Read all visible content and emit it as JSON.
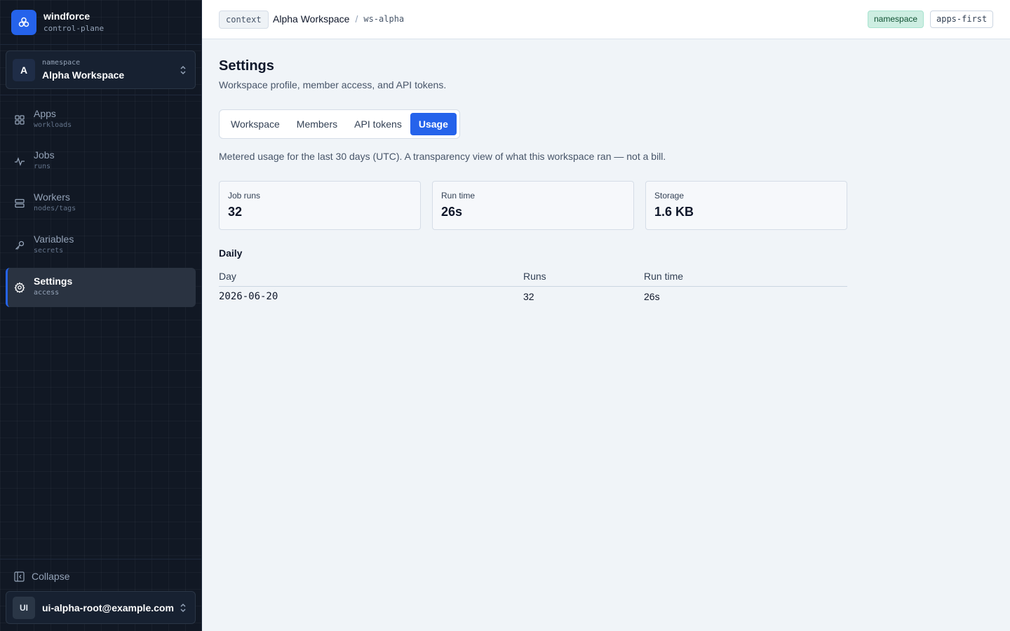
{
  "brand": {
    "name": "windforce",
    "subtitle": "control-plane"
  },
  "namespace_switcher": {
    "avatar": "A",
    "label": "namespace",
    "name": "Alpha Workspace"
  },
  "nav": {
    "items": [
      {
        "label": "Apps",
        "sub": "workloads",
        "icon": "grid-icon"
      },
      {
        "label": "Jobs",
        "sub": "runs",
        "icon": "activity-icon"
      },
      {
        "label": "Workers",
        "sub": "nodes/tags",
        "icon": "server-icon"
      },
      {
        "label": "Variables",
        "sub": "secrets",
        "icon": "key-icon"
      },
      {
        "label": "Settings",
        "sub": "access",
        "icon": "gear-icon",
        "active": true
      }
    ]
  },
  "footer": {
    "collapse_label": "Collapse",
    "user_avatar": "UI",
    "user_email": "ui-alpha-root@example.com"
  },
  "topbar": {
    "context_label": "context",
    "workspace_name": "Alpha Workspace",
    "separator": "/",
    "workspace_id": "ws-alpha",
    "tag_namespace": "namespace",
    "tag_apps": "apps-first"
  },
  "page": {
    "title": "Settings",
    "description": "Workspace profile, member access, and API tokens.",
    "tabs": [
      {
        "label": "Workspace"
      },
      {
        "label": "Members"
      },
      {
        "label": "API tokens"
      },
      {
        "label": "Usage",
        "active": true
      }
    ],
    "usage_note": "Metered usage for the last 30 days (UTC). A transparency view of what this workspace ran — not a bill."
  },
  "stats": [
    {
      "label": "Job runs",
      "value": "32"
    },
    {
      "label": "Run time",
      "value": "26s"
    },
    {
      "label": "Storage",
      "value": "1.6 KB"
    }
  ],
  "daily": {
    "title": "Daily",
    "headers": {
      "day": "Day",
      "runs": "Runs",
      "run_time": "Run time"
    },
    "rows": [
      {
        "day": "2026-06-20",
        "runs": "32",
        "run_time": "26s"
      }
    ]
  },
  "colors": {
    "accent": "#2563eb",
    "sidebar_bg": "#111824",
    "main_bg": "#f0f4f8",
    "tag_green": "#cdeee2"
  }
}
